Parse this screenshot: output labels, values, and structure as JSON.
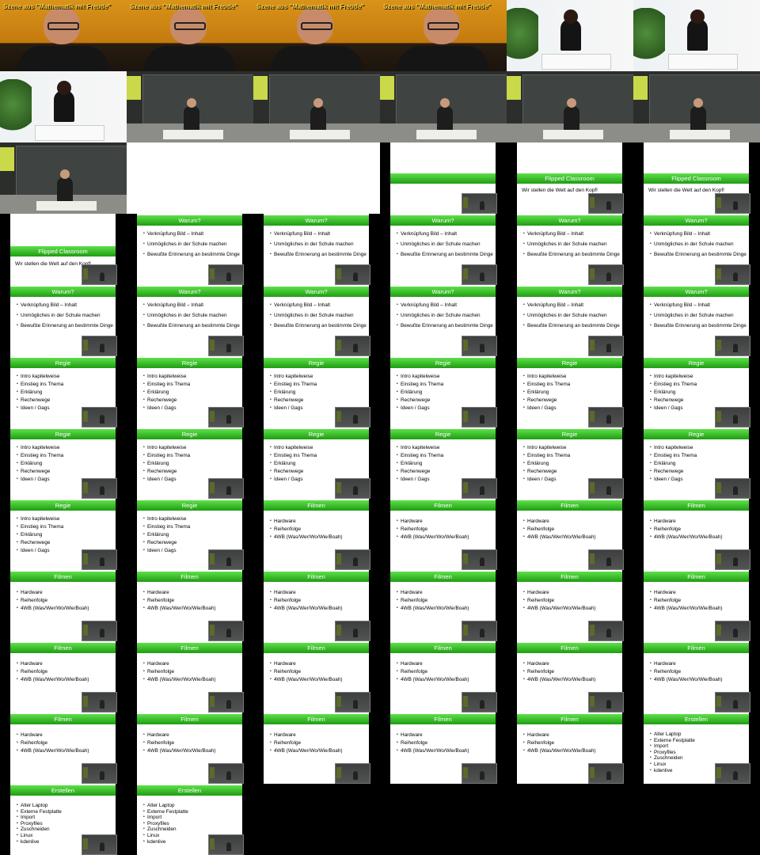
{
  "caption": "Szene aus \"Mathematik mit Freude\"",
  "frames": [
    {
      "type": "cam-orange",
      "caption": true
    },
    {
      "type": "cam-orange",
      "caption": true
    },
    {
      "type": "cam-orange",
      "caption": true
    },
    {
      "type": "cam-orange",
      "caption": true
    },
    {
      "type": "cam-room"
    },
    {
      "type": "cam-room"
    },
    {
      "type": "cam-room"
    },
    {
      "type": "cam-hall"
    },
    {
      "type": "cam-hall"
    },
    {
      "type": "cam-hall"
    },
    {
      "type": "cam-hall"
    },
    {
      "type": "cam-hall"
    },
    {
      "type": "cam-hall"
    },
    {
      "type": "blank"
    },
    {
      "type": "blank"
    },
    {
      "type": "slide",
      "title": "",
      "bar": "top",
      "pip": true
    },
    {
      "type": "slide",
      "title": "Flipped Classroom",
      "bar": "top",
      "subtitle": "Wir stellen die Welt auf den Kopf!",
      "pip": true
    },
    {
      "type": "slide",
      "title": "Flipped Classroom",
      "bar": "top",
      "subtitle": "Wir stellen die Welt auf den Kopf!",
      "pip": true
    },
    {
      "type": "slide",
      "title": "Flipped Classroom",
      "bar": "mid",
      "subtitle": "Wir stellen die Welt auf den Kopf!",
      "pip": true,
      "titleLow": true
    },
    {
      "type": "slide",
      "title": "Warum?",
      "list": "warum",
      "pip": true
    },
    {
      "type": "slide",
      "title": "Warum?",
      "list": "warum",
      "pip": true
    },
    {
      "type": "slide",
      "title": "Warum?",
      "list": "warum",
      "pip": true
    },
    {
      "type": "slide",
      "title": "Warum?",
      "list": "warum",
      "pip": true
    },
    {
      "type": "slide",
      "title": "Warum?",
      "list": "warum",
      "pip": true
    },
    {
      "type": "slide",
      "title": "Warum?",
      "list": "warum",
      "pip": true
    },
    {
      "type": "slide",
      "title": "Warum?",
      "list": "warum",
      "pip": true
    },
    {
      "type": "slide",
      "title": "Warum?",
      "list": "warum",
      "pip": true
    },
    {
      "type": "slide",
      "title": "Warum?",
      "list": "warum",
      "pip": true
    },
    {
      "type": "slide",
      "title": "Warum?",
      "list": "warum",
      "pip": true
    },
    {
      "type": "slide",
      "title": "Warum?",
      "list": "warum",
      "pip": true
    },
    {
      "type": "slide",
      "title": "Regie",
      "list": "regie",
      "pip": true
    },
    {
      "type": "slide",
      "title": "Regie",
      "list": "regie",
      "pip": true
    },
    {
      "type": "slide",
      "title": "Regie",
      "list": "regie",
      "pip": true
    },
    {
      "type": "slide",
      "title": "Regie",
      "list": "regie",
      "pip": true
    },
    {
      "type": "slide",
      "title": "Regie",
      "list": "regie",
      "pip": true
    },
    {
      "type": "slide",
      "title": "Regie",
      "list": "regie",
      "pip": true
    },
    {
      "type": "slide",
      "title": "Regie",
      "list": "regie",
      "pip": true
    },
    {
      "type": "slide",
      "title": "Regie",
      "list": "regie",
      "pip": true
    },
    {
      "type": "slide",
      "title": "Regie",
      "list": "regie",
      "pip": true
    },
    {
      "type": "slide",
      "title": "Regie",
      "list": "regie",
      "pip": true
    },
    {
      "type": "slide",
      "title": "Regie",
      "list": "regie",
      "pip": true
    },
    {
      "type": "slide",
      "title": "Regie",
      "list": "regie",
      "pip": true
    },
    {
      "type": "slide",
      "title": "Regie",
      "list": "regie",
      "pip": true
    },
    {
      "type": "slide",
      "title": "Regie",
      "list": "regie",
      "pip": true
    },
    {
      "type": "slide",
      "title": "Filmen",
      "list": "filmen",
      "pip": true
    },
    {
      "type": "slide",
      "title": "Filmen",
      "list": "filmen",
      "pip": true
    },
    {
      "type": "slide",
      "title": "Filmen",
      "list": "filmen",
      "pip": true
    },
    {
      "type": "slide",
      "title": "Filmen",
      "list": "filmen",
      "pip": true
    },
    {
      "type": "slide",
      "title": "Filmen",
      "list": "filmen",
      "pip": true
    },
    {
      "type": "slide",
      "title": "Filmen",
      "list": "filmen",
      "pip": true
    },
    {
      "type": "slide",
      "title": "Filmen",
      "list": "filmen",
      "pip": true
    },
    {
      "type": "slide",
      "title": "Filmen",
      "list": "filmen",
      "pip": true
    },
    {
      "type": "slide",
      "title": "Filmen",
      "list": "filmen",
      "pip": true
    },
    {
      "type": "slide",
      "title": "Filmen",
      "list": "filmen",
      "pip": true
    },
    {
      "type": "slide",
      "title": "Filmen",
      "list": "filmen",
      "pip": true
    },
    {
      "type": "slide",
      "title": "Filmen",
      "list": "filmen",
      "pip": true
    },
    {
      "type": "slide",
      "title": "Filmen",
      "list": "filmen",
      "pip": true
    },
    {
      "type": "slide",
      "title": "Filmen",
      "list": "filmen",
      "pip": true
    },
    {
      "type": "slide",
      "title": "Filmen",
      "list": "filmen",
      "pip": true
    },
    {
      "type": "slide",
      "title": "Filmen",
      "list": "filmen",
      "pip": true
    },
    {
      "type": "slide",
      "title": "Filmen",
      "list": "filmen",
      "pip": true
    },
    {
      "type": "slide",
      "title": "Filmen",
      "list": "filmen",
      "pip": true
    },
    {
      "type": "slide",
      "title": "Filmen",
      "list": "filmen",
      "pip": true
    },
    {
      "type": "slide",
      "title": "Filmen",
      "list": "filmen",
      "pip": true
    },
    {
      "type": "slide",
      "title": "Filmen",
      "list": "filmen",
      "pip": true
    },
    {
      "type": "slide",
      "title": "Erstellen",
      "list": "erstellen",
      "pip": true
    },
    {
      "type": "slide",
      "title": "Erstellen",
      "list": "erstellen",
      "pip": true
    },
    {
      "type": "slide",
      "title": "Erstellen",
      "list": "erstellen",
      "pip": true
    }
  ],
  "lists": {
    "warum": [
      "Verknüpfung Bild – Inhalt",
      "Unmögliches in der Schule machen",
      "Bewußte Erinnerung an bestimmte Dinge"
    ],
    "regie": [
      "Intro kapitelweise",
      "Einstieg ins Thema",
      "Erklärung",
      "Rechenwege",
      "Ideen / Gags"
    ],
    "filmen": [
      "Hardware",
      "Reihenfolge",
      "4WB (Was/Wer/Wo/Wie/Boah)"
    ],
    "erstellen": [
      "Alter Laptop",
      "Externe Festplatte",
      "Import",
      "Proxyfiles",
      "Zuschneiden",
      "Linux",
      "kdenlive"
    ]
  },
  "colors": {
    "bar_top": "#5ee04a",
    "bar_bottom": "#1f9d12",
    "background": "#000000"
  }
}
